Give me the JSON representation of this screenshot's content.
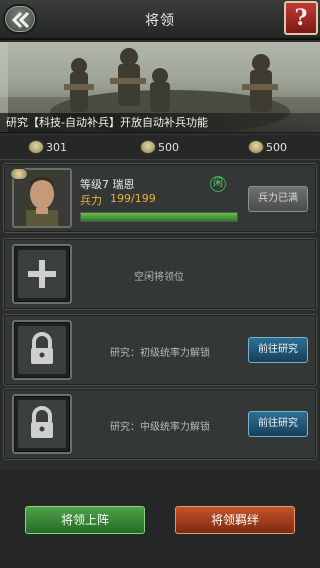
{
  "header": {
    "title": "将领",
    "help_label": "?"
  },
  "banner": {
    "text": "研究【科技-自动补兵】开放自动补兵功能"
  },
  "resources": [
    {
      "icon": "rank-badge-icon",
      "value": "301"
    },
    {
      "icon": "rank-badge-icon",
      "value": "500"
    },
    {
      "icon": "rank-badge-icon",
      "value": "500"
    }
  ],
  "general": {
    "name_line": "等级7 瑞恩",
    "troops_label": "兵力",
    "troops_value": "199/199",
    "troops_fill": 1.0,
    "status": "闲",
    "full_button": "兵力已满"
  },
  "slots": {
    "empty_label": "空闲将领位",
    "locked": [
      {
        "text": "研究：初级统率力解锁",
        "button": "前往研究"
      },
      {
        "text": "研究：中级统率力解锁",
        "button": "前往研究"
      }
    ]
  },
  "footer": {
    "deploy_button": "将领上阵",
    "bond_button": "将领羁绊"
  },
  "colors": {
    "accent_green": "#3f9a3b",
    "accent_orange": "#b2461f",
    "accent_blue": "#236184",
    "help_red": "#b32b26"
  }
}
